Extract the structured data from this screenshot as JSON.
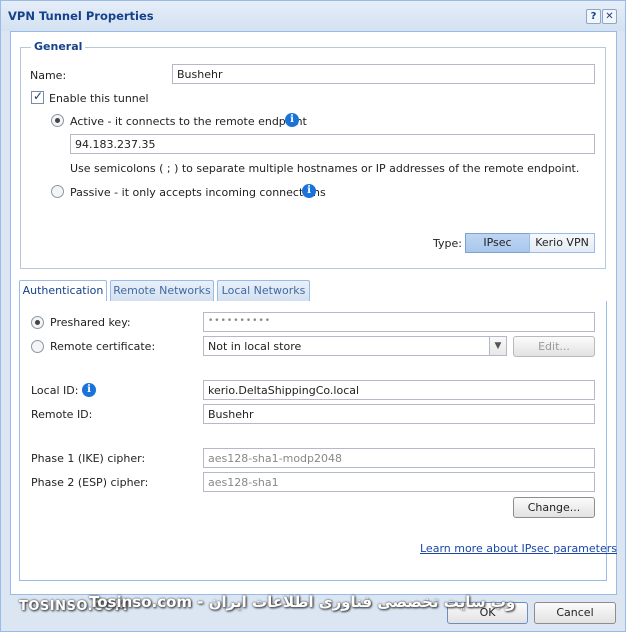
{
  "window": {
    "title": "VPN Tunnel Properties",
    "help_glyph": "?",
    "close_glyph": "✕"
  },
  "general": {
    "legend": "General",
    "name_label": "Name:",
    "name_value": "Bushehr",
    "enable_label": "Enable this tunnel",
    "enable_checked": true,
    "active_label": "Active - it connects to the remote endpoint",
    "endpoint_value": "94.183.237.35",
    "endpoint_hint": "Use semicolons ( ; ) to separate multiple hostnames or IP addresses of the remote endpoint.",
    "passive_label": "Passive - it only accepts incoming connections",
    "type_label": "Type:",
    "type_options": [
      "IPsec",
      "Kerio VPN"
    ],
    "type_selected": "IPsec"
  },
  "tabs": [
    {
      "label": "Authentication",
      "active": true
    },
    {
      "label": "Remote Networks",
      "active": false
    },
    {
      "label": "Local Networks",
      "active": false
    }
  ],
  "auth": {
    "preshared_label": "Preshared key:",
    "preshared_value": "••••••••••",
    "remote_cert_label": "Remote certificate:",
    "remote_cert_value": "Not in local store",
    "edit_button": "Edit...",
    "local_id_label": "Local ID:",
    "local_id_value": "kerio.DeltaShippingCo.local",
    "remote_id_label": "Remote ID:",
    "remote_id_value": "Bushehr",
    "phase1_label": "Phase 1 (IKE) cipher:",
    "phase1_value": "aes128-sha1-modp2048",
    "phase2_label": "Phase 2 (ESP) cipher:",
    "phase2_value": "aes128-sha1",
    "change_button": "Change...",
    "learn_link": "Learn more about IPsec parameters"
  },
  "footer": {
    "ok_button": "OK",
    "cancel_button": "Cancel"
  },
  "watermark": {
    "left": "TOSINSO.COM",
    "right": "وب سایت تخصصی فناوری اطلاعات ایران - Tosinso.com"
  },
  "icons": {
    "info": "info-icon",
    "help": "help-icon",
    "close": "close-icon",
    "combo": "chevron-down-icon"
  }
}
